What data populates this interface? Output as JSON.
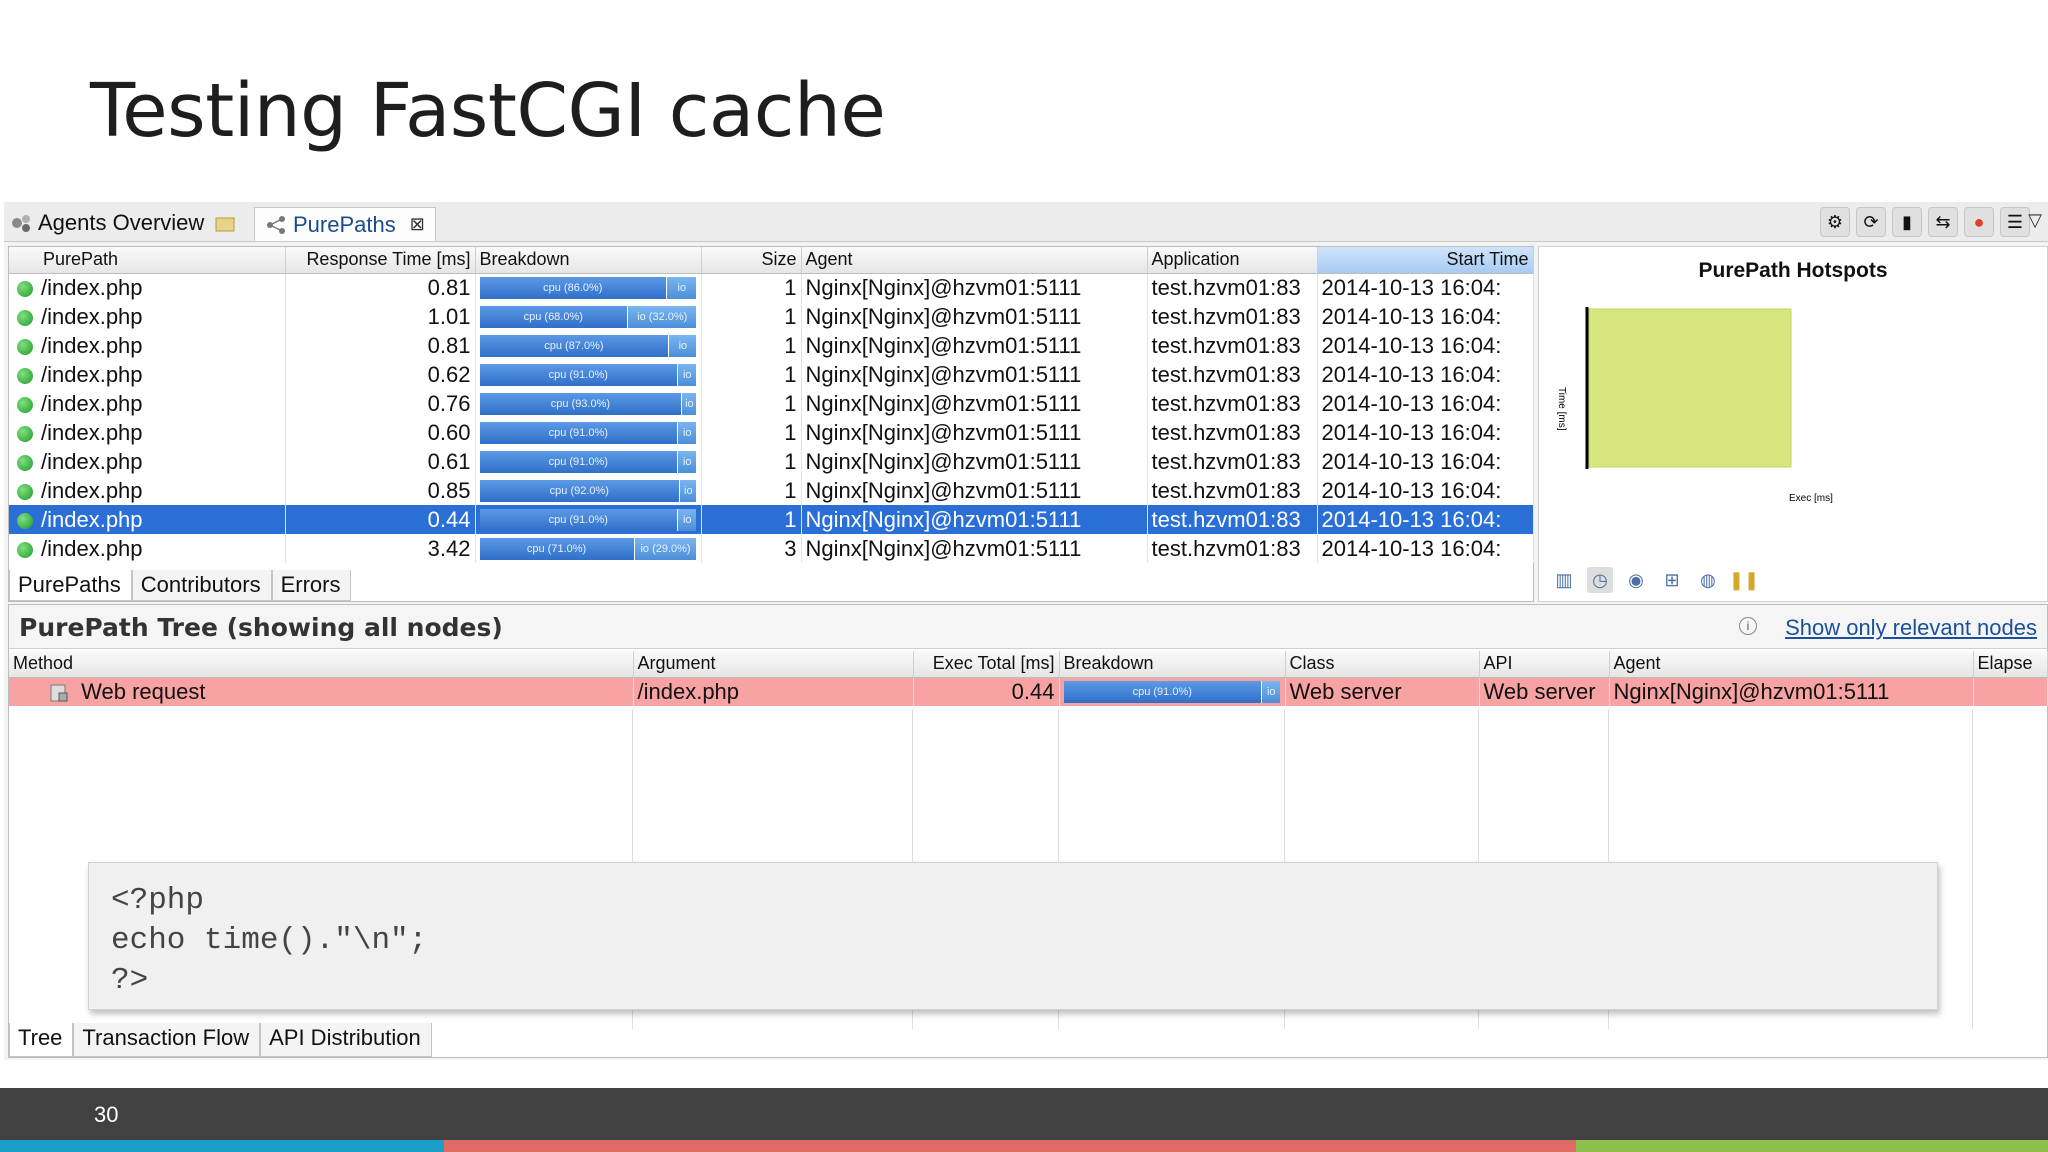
{
  "slide": {
    "title": "Testing FastCGI cache",
    "page_number": "30"
  },
  "tabs": {
    "agents": "Agents Overview",
    "purepaths": "PurePaths",
    "close": "⊠"
  },
  "purepaths_table": {
    "headers": [
      "PurePath",
      "Response Time [ms]",
      "Breakdown",
      "Size",
      "Agent",
      "Application",
      "Start Time"
    ],
    "rows": [
      {
        "path": "/index.php",
        "rt": "0.81",
        "cpu": "cpu (86.0%)",
        "cpu_pct": 86,
        "io": "io",
        "size": "1",
        "agent": "Nginx[Nginx]@hzvm01:5111",
        "app": "test.hzvm01:83",
        "start": "2014-10-13 16:04:"
      },
      {
        "path": "/index.php",
        "rt": "1.01",
        "cpu": "cpu (68.0%)",
        "cpu_pct": 68,
        "io": "io (32.0%)",
        "size": "1",
        "agent": "Nginx[Nginx]@hzvm01:5111",
        "app": "test.hzvm01:83",
        "start": "2014-10-13 16:04:"
      },
      {
        "path": "/index.php",
        "rt": "0.81",
        "cpu": "cpu (87.0%)",
        "cpu_pct": 87,
        "io": "io",
        "size": "1",
        "agent": "Nginx[Nginx]@hzvm01:5111",
        "app": "test.hzvm01:83",
        "start": "2014-10-13 16:04:"
      },
      {
        "path": "/index.php",
        "rt": "0.62",
        "cpu": "cpu (91.0%)",
        "cpu_pct": 91,
        "io": "io",
        "size": "1",
        "agent": "Nginx[Nginx]@hzvm01:5111",
        "app": "test.hzvm01:83",
        "start": "2014-10-13 16:04:"
      },
      {
        "path": "/index.php",
        "rt": "0.76",
        "cpu": "cpu (93.0%)",
        "cpu_pct": 93,
        "io": "io",
        "size": "1",
        "agent": "Nginx[Nginx]@hzvm01:5111",
        "app": "test.hzvm01:83",
        "start": "2014-10-13 16:04:"
      },
      {
        "path": "/index.php",
        "rt": "0.60",
        "cpu": "cpu (91.0%)",
        "cpu_pct": 91,
        "io": "io",
        "size": "1",
        "agent": "Nginx[Nginx]@hzvm01:5111",
        "app": "test.hzvm01:83",
        "start": "2014-10-13 16:04:"
      },
      {
        "path": "/index.php",
        "rt": "0.61",
        "cpu": "cpu (91.0%)",
        "cpu_pct": 91,
        "io": "io",
        "size": "1",
        "agent": "Nginx[Nginx]@hzvm01:5111",
        "app": "test.hzvm01:83",
        "start": "2014-10-13 16:04:"
      },
      {
        "path": "/index.php",
        "rt": "0.85",
        "cpu": "cpu (92.0%)",
        "cpu_pct": 92,
        "io": "io",
        "size": "1",
        "agent": "Nginx[Nginx]@hzvm01:5111",
        "app": "test.hzvm01:83",
        "start": "2014-10-13 16:04:"
      },
      {
        "path": "/index.php",
        "rt": "0.44",
        "cpu": "cpu (91.0%)",
        "cpu_pct": 91,
        "io": "io",
        "size": "1",
        "agent": "Nginx[Nginx]@hzvm01:5111",
        "app": "test.hzvm01:83",
        "start": "2014-10-13 16:04:",
        "selected": true
      },
      {
        "path": "/index.php",
        "rt": "3.42",
        "cpu": "cpu (71.0%)",
        "cpu_pct": 71,
        "io": "io (29.0%)",
        "size": "3",
        "agent": "Nginx[Nginx]@hzvm01:5111",
        "app": "test.hzvm01:83",
        "start": "2014-10-13 16:04:"
      }
    ],
    "bottom_tabs": [
      "PurePaths",
      "Contributors",
      "Errors"
    ]
  },
  "hotspots": {
    "title": "PurePath Hotspots",
    "ylabel": "Time [ms]",
    "xlabel": "Exec [ms]",
    "fill_color": "#d8e67e"
  },
  "tree": {
    "title": "PurePath Tree (showing all nodes)",
    "relevant_link": "Show only relevant nodes",
    "headers": [
      "Method",
      "Argument",
      "Exec Total [ms]",
      "Breakdown",
      "Class",
      "API",
      "Agent",
      "Elapse"
    ],
    "row": {
      "method": "Web request",
      "argument": "/index.php",
      "exec": "0.44",
      "cpu": "cpu (91.0%)",
      "io": "io",
      "class": "Web server",
      "api": "Web server",
      "agent": "Nginx[Nginx]@hzvm01:5111"
    },
    "tabs": [
      "Tree",
      "Transaction Flow",
      "API Distribution"
    ]
  },
  "code": {
    "line1": "<?php",
    "line2": "echo time().\"\\n\";",
    "line3": "?>"
  },
  "colors": {
    "selection": "#2a6fd6",
    "error_row": "#f7a3a3",
    "footer": "#414142",
    "stripe_blue": "#1a9fc9",
    "stripe_red": "#e06a64",
    "stripe_green": "#8cbf4c"
  }
}
